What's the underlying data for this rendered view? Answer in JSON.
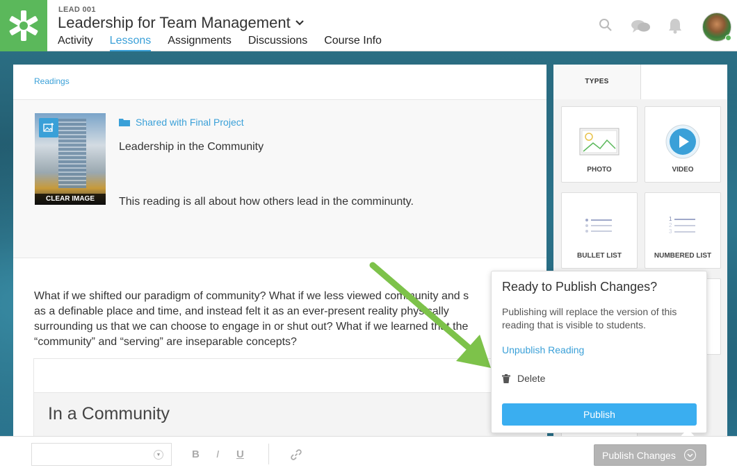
{
  "header": {
    "course_code": "LEAD 001",
    "course_title": "Leadership for Team Management",
    "nav": [
      "Activity",
      "Lessons",
      "Assignments",
      "Discussions",
      "Course Info"
    ],
    "active_nav": "Lessons",
    "brand_color": "#5bb85b",
    "accent_color": "#3aa0d8"
  },
  "main": {
    "breadcrumb": "Readings",
    "thumbnail_button": "CLEAR IMAGE",
    "shared_label": "Shared with Final Project",
    "reading_title": "Leadership in the Community",
    "reading_description": "This reading is all about how others lead in the comminunty.",
    "body_line1": "What if we shifted our paradigm of community? What if we less viewed community and s",
    "body_line2": "as a definable place and time, and instead felt it as an ever-present reality physically",
    "body_line3": "surrounding us that we can choose to engage in or shut out? What if we learned that the",
    "body_line4": "“community” and “serving” are inseparable concepts?",
    "sub_heading": "In a Community"
  },
  "panel": {
    "tab_label": "TYPES",
    "tiles": [
      "PHOTO",
      "VIDEO",
      "BULLET LIST",
      "NUMBERED LIST"
    ]
  },
  "popover": {
    "title": "Ready to Publish Changes?",
    "text": "Publishing will replace the version of this reading that is visible to students.",
    "unpublish": "Unpublish Reading",
    "delete": "Delete",
    "publish": "Publish"
  },
  "toolbar": {
    "bold": "B",
    "italic": "I",
    "underline": "U",
    "publish_changes": "Publish Changes"
  }
}
